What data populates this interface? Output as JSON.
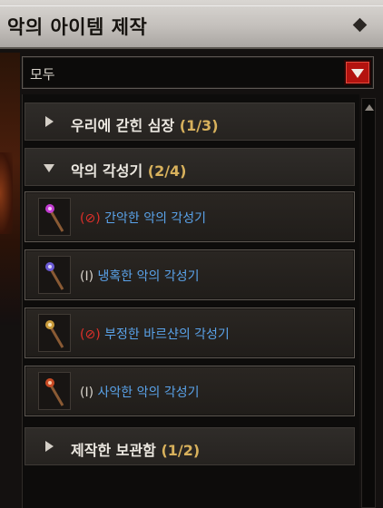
{
  "title": "악의 아이템 제작",
  "filter": {
    "selected": "모두"
  },
  "categories": [
    {
      "name": "우리에 갇힌 심장",
      "count": "(1/3)",
      "expanded": false
    },
    {
      "name": "악의 각성기",
      "count": "(2/4)",
      "expanded": true
    },
    {
      "name": "제작한 보관함",
      "count": "(1/2)",
      "expanded": false
    }
  ],
  "items": [
    {
      "tag": "(⊘)",
      "tag_color": "#e0302a",
      "name": "간악한 악의 각성기",
      "icon": "awakener-staff-icon",
      "gem_color": "#c23bd1"
    },
    {
      "tag": "(I)",
      "tag_color": "#d8d3cb",
      "name": "냉혹한 악의 각성기",
      "icon": "awakener-staff-icon",
      "gem_color": "#6b5bd6"
    },
    {
      "tag": "(⊘)",
      "tag_color": "#e0302a",
      "name": "부정한 바르샨의 각성기",
      "icon": "awakener-staff-icon",
      "gem_color": "#c89a3a"
    },
    {
      "tag": "(I)",
      "tag_color": "#d8d3cb",
      "name": "사악한 악의 각성기",
      "icon": "awakener-staff-icon",
      "gem_color": "#c84a24"
    }
  ],
  "colors": {
    "accent_red": "#b3130f",
    "count_gold": "#d8b15c",
    "item_blue": "#5aa3ea"
  }
}
